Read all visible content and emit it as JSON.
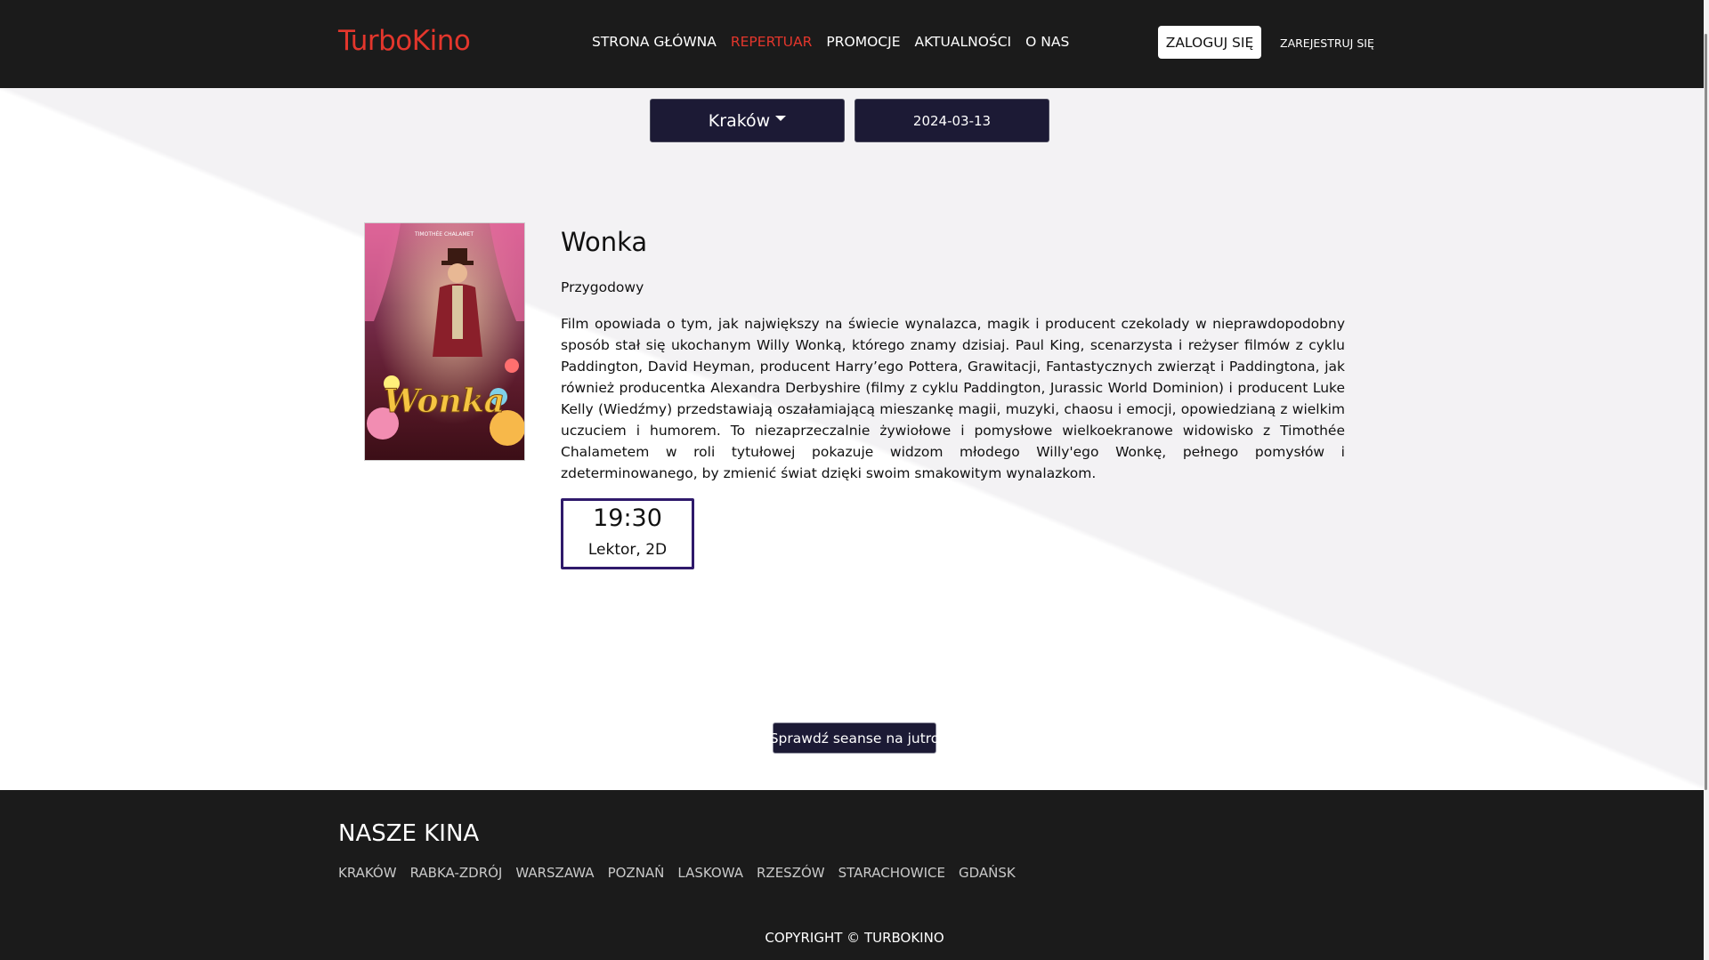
{
  "header": {
    "brand": "TurboKino",
    "nav": [
      {
        "label": "STRONA GŁÓWNA",
        "active": false
      },
      {
        "label": "REPERTUAR",
        "active": true
      },
      {
        "label": "PROMOCJE",
        "active": false
      },
      {
        "label": "AKTUALNOŚCI",
        "active": false
      },
      {
        "label": "O NAS",
        "active": false
      }
    ],
    "login_label": "ZALOGUJ SIĘ",
    "register_label": "ZAREJESTRUJ SIĘ"
  },
  "filters": {
    "city": "Kraków",
    "date": "2024-03-13"
  },
  "movie": {
    "title": "Wonka",
    "genre": "Przygodowy",
    "description": "Film opowiada o tym, jak największy na świecie wynalazca, magik i producent czekolady w nieprawdopodobny sposób stał się ukochanym Willy Wonką, którego znamy dzisiaj. Paul King, scenarzysta i reżyser filmów z cyklu Paddington, David Heyman, producent Harry’ego Pottera, Grawitacji, Fantastycznych zwierząt i Paddingtona, jak również producentka Alexandra Derbyshire (filmy z cyklu Paddington, Jurassic World Dominion) i producent Luke Kelly (Wiedźmy) przedstawiają oszałamiającą mieszankę magii, muzyki, chaosu i emocji, opowiedzianą z wielkim uczuciem i humorem. To niezaprzeczalnie żywiołowe i pomysłowe wielkoekranowe widowisko z Timothée Chalametem w roli tytułowej pokazuje widzom młodego Willy'ego Wonkę, pełnego pomysłów i zdeterminowanego, by zmienić świat dzięki swoim smakowitym wynalazkom.",
    "poster_title": "Wonka",
    "poster_credit": "TIMOTHÉE CHALAMET",
    "showtimes": [
      {
        "time": "19:30",
        "type": "Lektor, 2D"
      }
    ]
  },
  "tomorrow_label": "Sprawdź seanse na jutro",
  "footer": {
    "title": "NASZE KINA",
    "cinemas": [
      "KRAKÓW",
      "RABKA-ZDRÓJ",
      "WARSZAWA",
      "POZNAŃ",
      "LASKOWA",
      "RZESZÓW",
      "STARACHOWICE",
      "GDAŃSK"
    ],
    "copyright": "COPYRIGHT © TURBOKINO"
  },
  "colors": {
    "brand": "#e3362c",
    "dark": "#1b1b1b",
    "button": "#1c1a35",
    "showtime_border": "#2f1a6b"
  }
}
